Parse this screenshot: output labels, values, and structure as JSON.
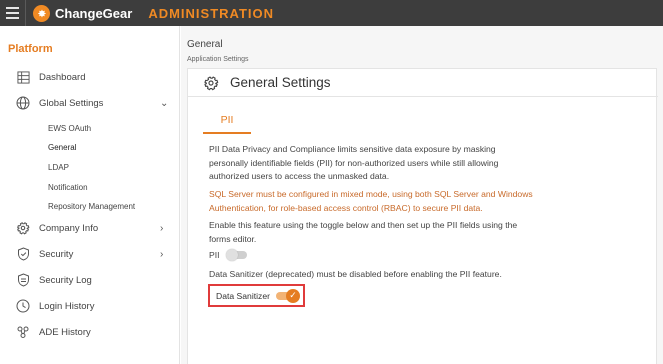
{
  "topbar": {
    "app_name": "ChangeGear",
    "section": "ADMINISTRATION"
  },
  "sidebar": {
    "title": "Platform",
    "dashboard": "Dashboard",
    "global_settings": "Global Settings",
    "sub": {
      "ews_oauth": "EWS OAuth",
      "general": "General",
      "ldap": "LDAP",
      "notification": "Notification",
      "repository_management": "Repository Management"
    },
    "company_info": "Company Info",
    "security": "Security",
    "security_log": "Security Log",
    "login_history": "Login History",
    "ade_history": "ADE History"
  },
  "main": {
    "breadcrumb": "General",
    "sub_breadcrumb": "Application Settings",
    "title": "General Settings",
    "tab_label": "PII",
    "p1_lines": [
      "PII Data Privacy and Compliance limits sensitive data exposure by masking",
      "personally identifiable fields (PII) for non-authorized users while still allowing",
      "authorized users to access the unmasked data."
    ],
    "p2_lines": [
      "SQL Server must be configured in mixed mode, using both SQL Server and Windows",
      "Authentication, for role-based access control (RBAC) to secure PII data."
    ],
    "p3_lines": [
      "Enable this feature using the toggle below and then set up the PII fields using the",
      "forms editor."
    ],
    "pii_toggle_label": "PII",
    "p4": "Data Sanitizer (deprecated) must be disabled before enabling the PII feature.",
    "ds_toggle_label": "Data Sanitizer",
    "accent_color": "#e57d22",
    "highlight_color": "#e03b3b"
  }
}
